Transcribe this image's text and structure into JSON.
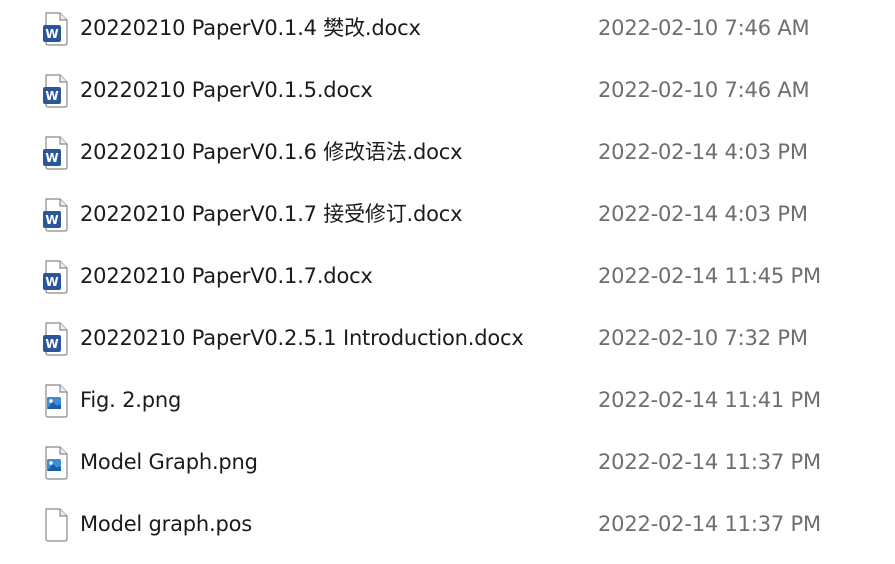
{
  "files": [
    {
      "name": "20220210 PaperV0.1.4 樊改.docx",
      "date": "2022-02-10 7:46 AM",
      "icon": "word-document-icon",
      "type": "word"
    },
    {
      "name": "20220210 PaperV0.1.5.docx",
      "date": "2022-02-10 7:46 AM",
      "icon": "word-document-icon",
      "type": "word"
    },
    {
      "name": "20220210 PaperV0.1.6 修改语法.docx",
      "date": "2022-02-14 4:03 PM",
      "icon": "word-document-icon",
      "type": "word"
    },
    {
      "name": "20220210 PaperV0.1.7 接受修订.docx",
      "date": "2022-02-14 4:03 PM",
      "icon": "word-document-icon",
      "type": "word"
    },
    {
      "name": "20220210 PaperV0.1.7.docx",
      "date": "2022-02-14 11:45 PM",
      "icon": "word-document-icon",
      "type": "word"
    },
    {
      "name": "20220210 PaperV0.2.5.1 Introduction.docx",
      "date": "2022-02-10 7:32 PM",
      "icon": "word-document-icon",
      "type": "word"
    },
    {
      "name": "Fig. 2.png",
      "date": "2022-02-14 11:41 PM",
      "icon": "image-file-icon",
      "type": "image"
    },
    {
      "name": "Model Graph.png",
      "date": "2022-02-14 11:37 PM",
      "icon": "image-file-icon",
      "type": "image"
    },
    {
      "name": "Model graph.pos",
      "date": "2022-02-14 11:37 PM",
      "icon": "generic-file-icon",
      "type": "generic"
    }
  ],
  "colors": {
    "word_blue": "#2b579a",
    "name_text": "#1b1b1b",
    "date_text": "#6e6e6e"
  }
}
